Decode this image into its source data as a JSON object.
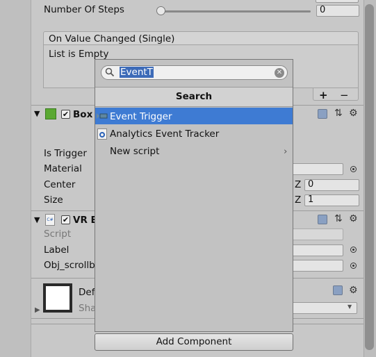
{
  "slider": {
    "label": "Number Of Steps",
    "value": "0",
    "fraction": 0
  },
  "event": {
    "header": "On Value Changed (Single)",
    "list_text": "List is Empty",
    "plus": "+",
    "minus": "−"
  },
  "box_collider": {
    "title": "Box",
    "enabled": "✔",
    "is_trigger": "Is Trigger",
    "material": "Material",
    "center": "Center",
    "size": "Size",
    "center_z_label": "Z",
    "center_z_value": "0",
    "size_z_label": "Z",
    "size_z_value": "1"
  },
  "vr_component": {
    "title": "VR E",
    "enabled": "✔",
    "script": "Script",
    "label": "Label",
    "obj_scroll": "Obj_scrollb"
  },
  "material_block": {
    "name": "Def",
    "shader": "Sha"
  },
  "popup": {
    "search_value": "EventT",
    "header": "Search",
    "items": [
      {
        "label": "Event Trigger",
        "icon": "event-trigger-icon"
      },
      {
        "label": "Analytics Event Tracker",
        "icon": "csharp-script-icon"
      },
      {
        "label": "New script",
        "icon": "chevron-right-icon"
      }
    ]
  },
  "add_component": "Add Component",
  "colors": {
    "selection": "#3e7bd3",
    "panel": "#c8c8c8"
  }
}
